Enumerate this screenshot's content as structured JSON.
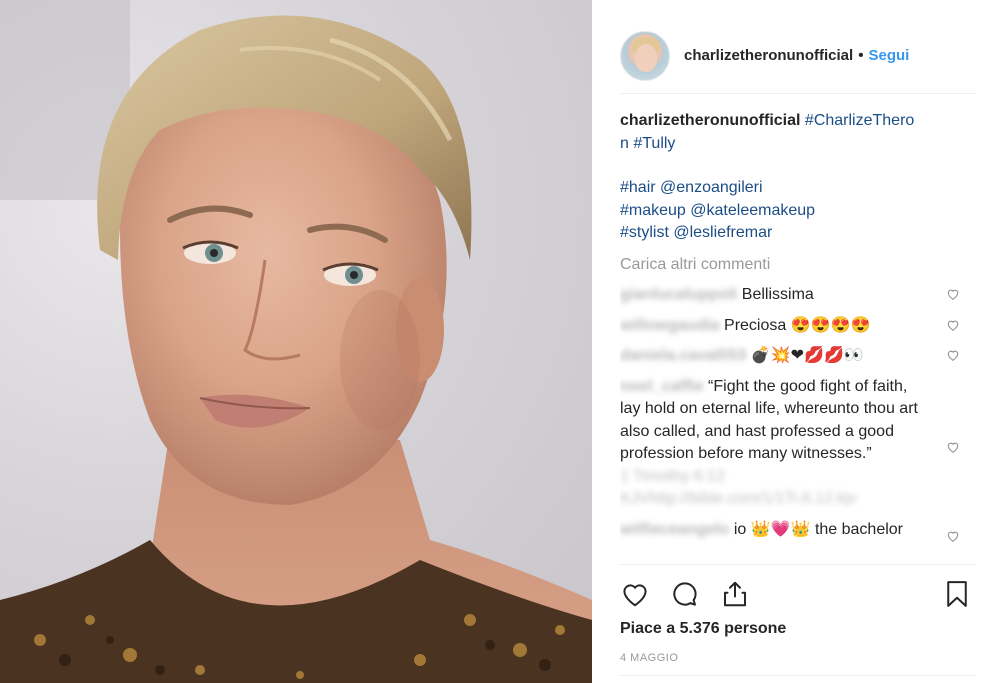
{
  "post": {
    "username": "charlizetheronunofficial",
    "separator": "•",
    "follow_label": "Segui"
  },
  "caption": {
    "username": "charlizetheronunofficial",
    "tags_line1": "#CharlizeThero",
    "tags_line1b": "n #Tully",
    "hair_tag": "#hair",
    "hair_credit": "@enzoangileri",
    "makeup_tag": "#makeup",
    "makeup_credit": "@kateleemakeup",
    "stylist_tag": "#stylist",
    "stylist_credit": "@lesliefremar"
  },
  "load_more_label": "Carica altri commenti",
  "comments": [
    {
      "user": "gianlucaluppoli",
      "text": "Bellissima"
    },
    {
      "user": "willowgaudia",
      "text": "Preciosa 😍😍😍😍"
    },
    {
      "user": "daniela.cavalli53",
      "text": "💣💥❤💋💋👀"
    },
    {
      "user": "noel_caffie",
      "text": "“Fight the good fight of faith, lay hold on eternal life, whereunto thou art also called, and hast professed a good profession before many witnesses.”",
      "extra1": "1 Timothy 6:12",
      "extra2": "KJVhttp://bible.com/1/1Ti.6.12.kjv"
    },
    {
      "user": "wilfieceangelo",
      "text": "io 👑💗👑 the bachelor"
    }
  ],
  "likes_text": "Piace a 5.376 persone",
  "date_text": "4 MAGGIO"
}
